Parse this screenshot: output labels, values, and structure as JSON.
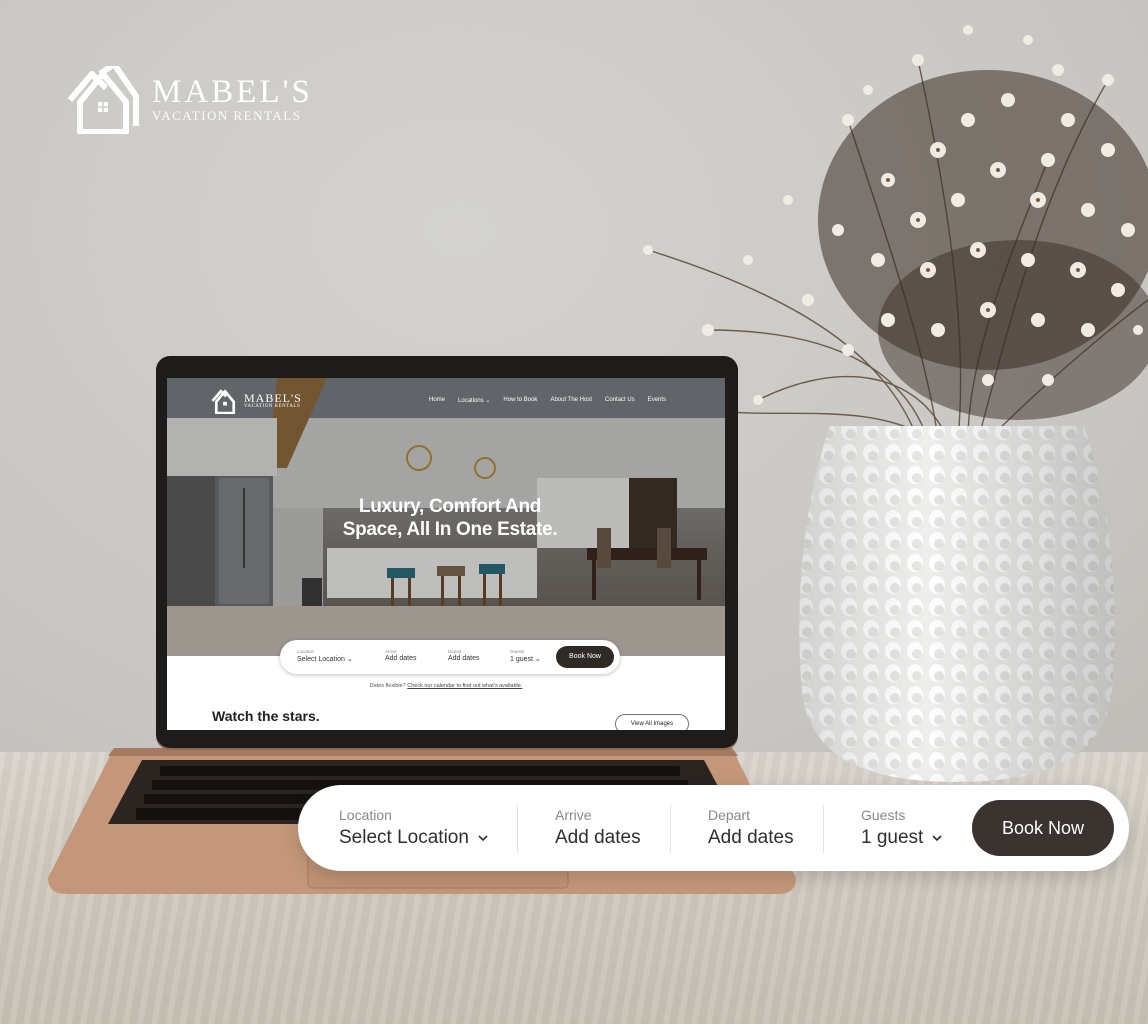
{
  "brand": {
    "name": "MABEL'S",
    "tagline": "VACATION RENTALS"
  },
  "laptop_site": {
    "brand": {
      "name": "MABEL'S",
      "tagline": "VACATION RENTALS"
    },
    "nav": {
      "home": "Home",
      "locations": "Locations",
      "how_to_book": "How to Book",
      "about_host": "About The Host",
      "contact": "Contact Us",
      "events": "Events"
    },
    "hero_title": "Luxury, Comfort And Space, All In One Estate.",
    "booking": {
      "location_label": "Location",
      "location_value": "Select Location",
      "arrive_label": "Arrive",
      "arrive_value": "Add dates",
      "depart_label": "Depart",
      "depart_value": "Add dates",
      "guests_label": "Guests",
      "guests_value": "1 guest",
      "book_label": "Book Now"
    },
    "flexible_note": "Dates flexible?",
    "flexible_link": "Check our calendar to find out what's available.",
    "section_title": "Watch the stars.",
    "view_all_label": "View All Images"
  },
  "booking_bar": {
    "location": {
      "label": "Location",
      "value": "Select Location"
    },
    "arrive": {
      "label": "Arrive",
      "value": "Add dates"
    },
    "depart": {
      "label": "Depart",
      "value": "Add dates"
    },
    "guests": {
      "label": "Guests",
      "value": "1 guest"
    },
    "book_button": "Book Now"
  },
  "colors": {
    "accent": "#3a3330",
    "white": "#ffffff",
    "muted_text": "#8a8a8a"
  }
}
